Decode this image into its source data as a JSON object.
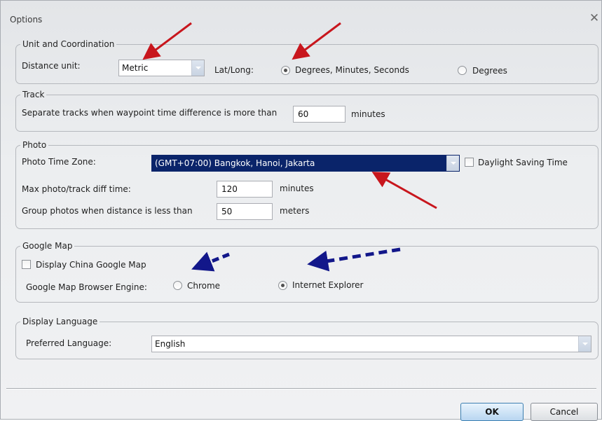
{
  "window": {
    "title": "Options",
    "close_glyph": "✕"
  },
  "unit": {
    "legend": "Unit and Coordination",
    "distance_label": "Distance unit:",
    "distance_value": "Metric",
    "latlong_label": "Lat/Long:",
    "dms_label": "Degrees, Minutes, Seconds",
    "degrees_label": "Degrees",
    "selected": "dms"
  },
  "track": {
    "legend": "Track",
    "separate_label": "Separate tracks when waypoint time difference is more than",
    "separate_value": "60",
    "unit": "minutes"
  },
  "photo": {
    "legend": "Photo",
    "timezone_label": "Photo Time Zone:",
    "timezone_value": "(GMT+07:00) Bangkok, Hanoi, Jakarta",
    "dst_label": "Daylight Saving Time",
    "dst_checked": false,
    "maxdiff_label": "Max photo/track diff time:",
    "maxdiff_value": "120",
    "maxdiff_unit": "minutes",
    "group_label": "Group photos when distance is less than",
    "group_value": "50",
    "group_unit": "meters"
  },
  "googlemap": {
    "legend": "Google Map",
    "china_label": "Display China Google Map",
    "china_checked": false,
    "engine_label": "Google Map Browser Engine:",
    "chrome_label": "Chrome",
    "ie_label": "Internet Explorer",
    "selected": "ie"
  },
  "language": {
    "legend": "Display Language",
    "preferred_label": "Preferred Language:",
    "preferred_value": "English"
  },
  "buttons": {
    "ok": "OK",
    "cancel": "Cancel"
  },
  "annotation_colors": {
    "red_arrow": "#c8161d",
    "blue_arrow": "#12178a"
  }
}
